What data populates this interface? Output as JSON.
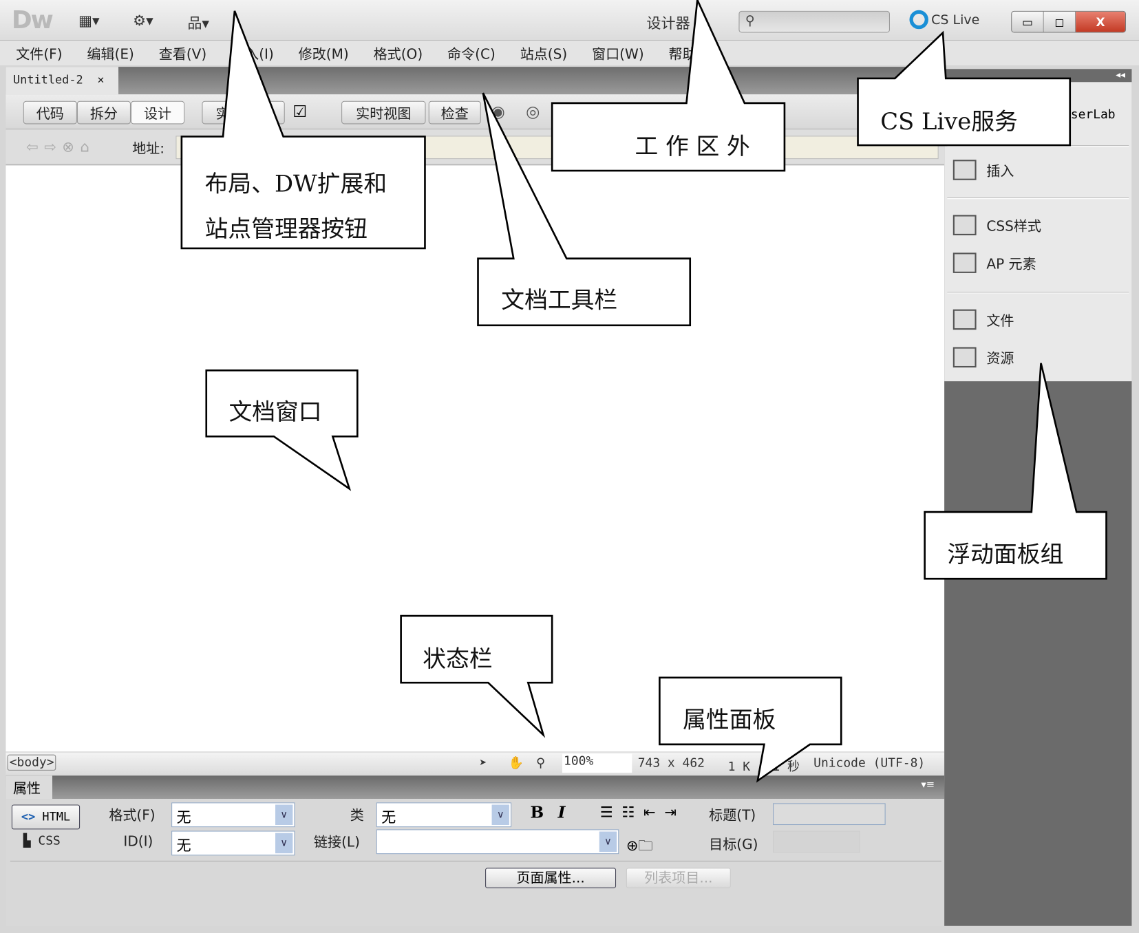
{
  "titlebar": {
    "logo": "Dw",
    "workspace": "设计器",
    "workspace_arrow": "▼",
    "search_placeholder": "",
    "cslive": "CS Live",
    "minimize": "▭",
    "maximize": "◻",
    "close": "X"
  },
  "menu": [
    "文件(F)",
    "编辑(E)",
    "查看(V)",
    "插入(I)",
    "修改(M)",
    "格式(O)",
    "命令(C)",
    "站点(S)",
    "窗口(W)",
    "帮助(H)"
  ],
  "document_tab": {
    "title": "Untitled-2",
    "close": "×"
  },
  "doc_toolbar": {
    "code": "代码",
    "split": "拆分",
    "design": "设计",
    "live_code": "实时代码",
    "live_view": "实时视图",
    "inspect": "检查"
  },
  "address_bar": {
    "label": "地址:",
    "value": ""
  },
  "status_bar": {
    "tag": "<body>",
    "zoom": "100%",
    "size": "743 x 462",
    "filesize": "1 K / 1 秒",
    "encoding": "Unicode (UTF-8)"
  },
  "properties": {
    "title": "属性",
    "html_btn": "HTML",
    "css_btn": "CSS",
    "format_label": "格式(F)",
    "format_value": "无",
    "id_label": "ID(I)",
    "id_value": "无",
    "class_label": "类",
    "class_value": "无",
    "link_label": "链接(L)",
    "link_value": "",
    "bold": "B",
    "italic": "I",
    "title_label": "标题(T)",
    "target_label": "目标(G)",
    "page_props": "页面属性...",
    "list_item": "列表项目..."
  },
  "right_panel": {
    "partial_label": "serLab",
    "items": [
      "插入",
      "CSS样式",
      "AP 元素",
      "文件",
      "资源"
    ]
  },
  "callouts": {
    "layout": [
      "布局、DW扩展和",
      "站点管理器按钮"
    ],
    "outside": "工 作 区 外",
    "cslive": "CS Live服务",
    "doc_toolbar": "文档工具栏",
    "doc_window": "文档窗口",
    "float_panels": "浮动面板组",
    "status_bar": "状态栏",
    "prop_panel": "属性面板"
  }
}
